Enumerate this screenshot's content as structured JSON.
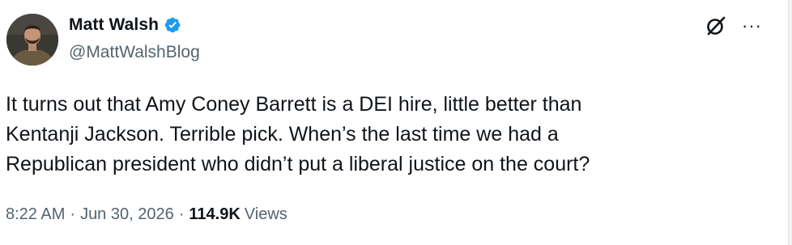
{
  "tweet": {
    "display_name": "Matt Walsh",
    "handle": "@MattWalshBlog",
    "verified_color": "#1d9bf0",
    "text": "It turns out that Amy Coney Barrett is a DEI hire, little better than\nKentanji Jackson. Terrible pick. When’s the last time we had a\nRepublican president who didn’t put a liberal justice on the court?",
    "time": "8:22 AM",
    "separator": "·",
    "date": "Jun 30, 2026",
    "views_count": "114.9K",
    "views_label": "Views",
    "more_glyph": "···"
  },
  "icons": {
    "verified": "verified-badge-icon",
    "grok": "grok-icon",
    "more": "more-options-icon"
  }
}
